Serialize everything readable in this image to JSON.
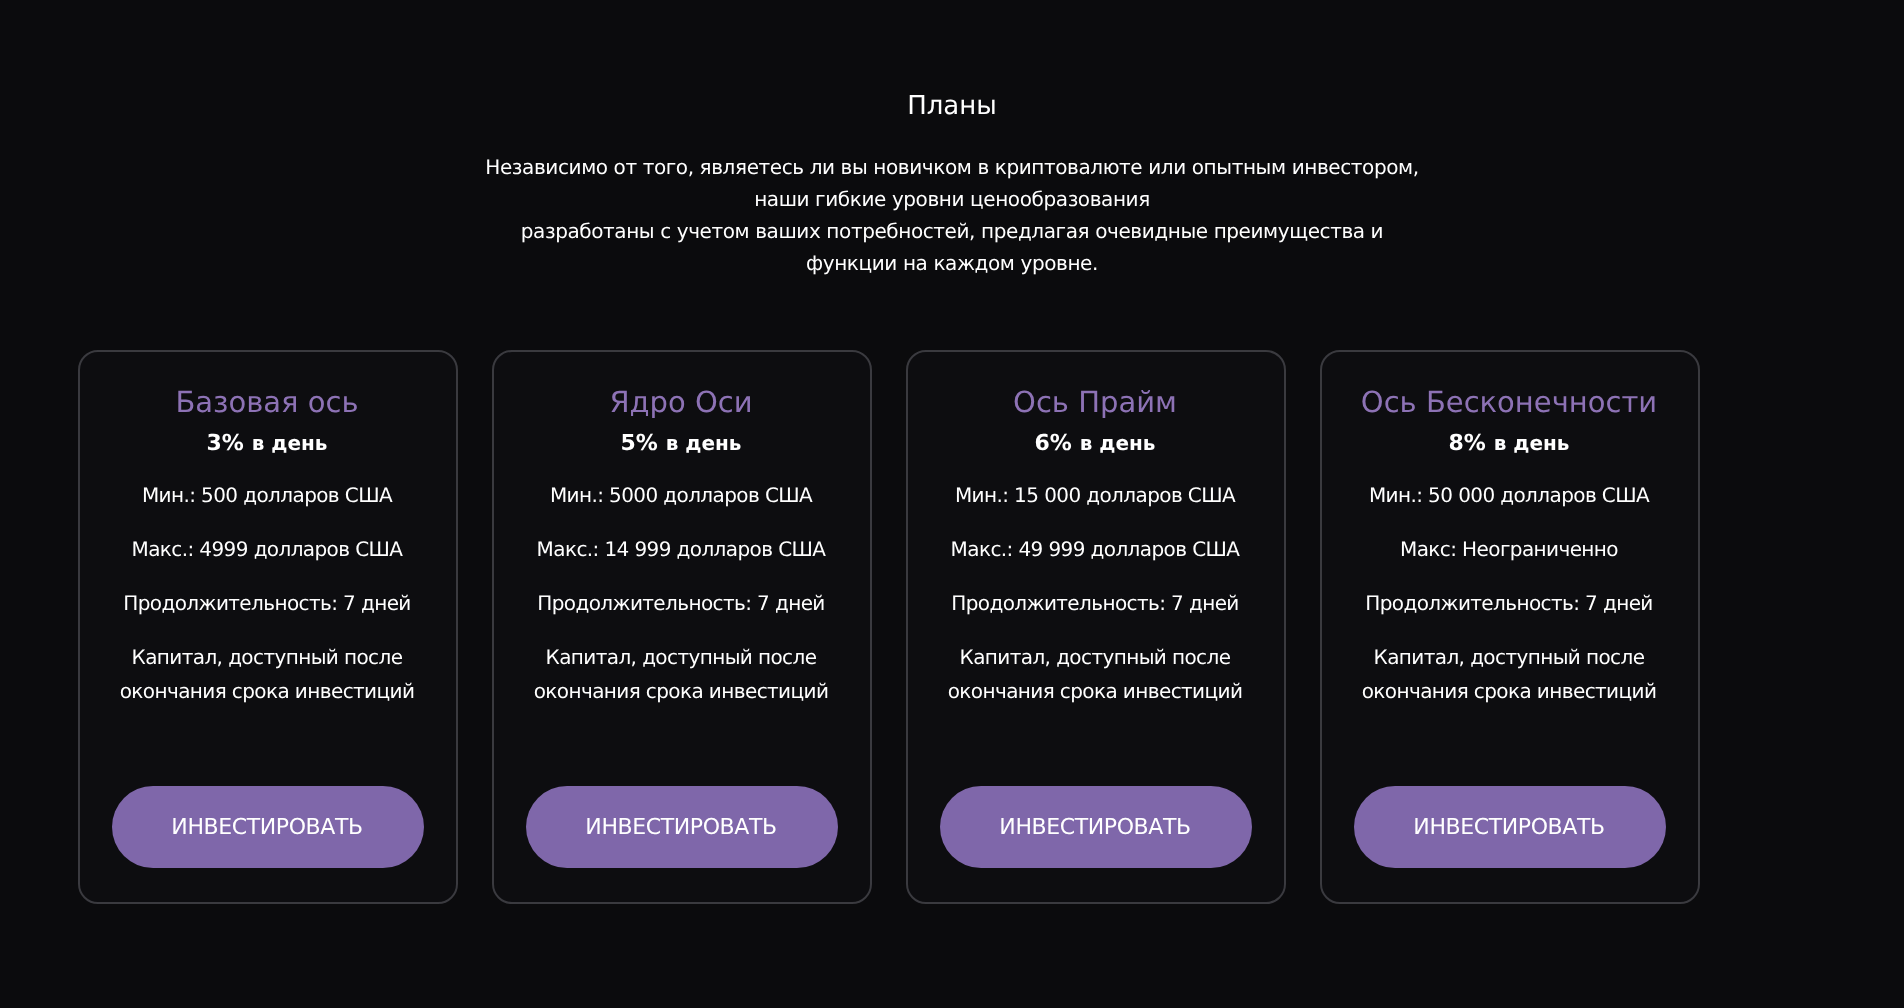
{
  "heading": "Планы",
  "description": [
    "Независимо от того, являетесь ли вы новичком в криптовалюте или опытным инвестором,",
    "наши гибкие уровни ценообразования",
    "разработаны с учетом ваших потребностей, предлагая очевидные преимущества и",
    "функции на каждом уровне."
  ],
  "plans": [
    {
      "name": "Базовая ось",
      "rate": "3%",
      "rate_unit": "в день",
      "features": [
        "Мин.: 500 долларов США",
        "Макс.: 4999 долларов США",
        "Продолжительность: 7 дней",
        "Капитал, доступный после окончания срока инвестиций"
      ],
      "button": "ИНВЕСТИРОВАТЬ"
    },
    {
      "name": "Ядро Оси",
      "rate": "5%",
      "rate_unit": "в день",
      "features": [
        "Мин.: 5000 долларов США",
        "Макс.: 14 999 долларов США",
        "Продолжительность: 7 дней",
        "Капитал, доступный после окончания срока инвестиций"
      ],
      "button": "ИНВЕСТИРОВАТЬ"
    },
    {
      "name": "Ось Прайм",
      "rate": "6%",
      "rate_unit": "в день",
      "features": [
        "Мин.: 15 000 долларов США",
        "Макс.: 49 999 долларов США",
        "Продолжительность: 7 дней",
        "Капитал, доступный после окончания срока инвестиций"
      ],
      "button": "ИНВЕСТИРОВАТЬ"
    },
    {
      "name": "Ось Бесконечности",
      "rate": "8%",
      "rate_unit": "в день",
      "features": [
        "Мин.: 50 000 долларов США",
        "Макс: Неограниченно",
        "Продолжительность: 7 дней",
        "Капитал, доступный после окончания срока инвестиций"
      ],
      "button": "ИНВЕСТИРОВАТЬ"
    }
  ]
}
